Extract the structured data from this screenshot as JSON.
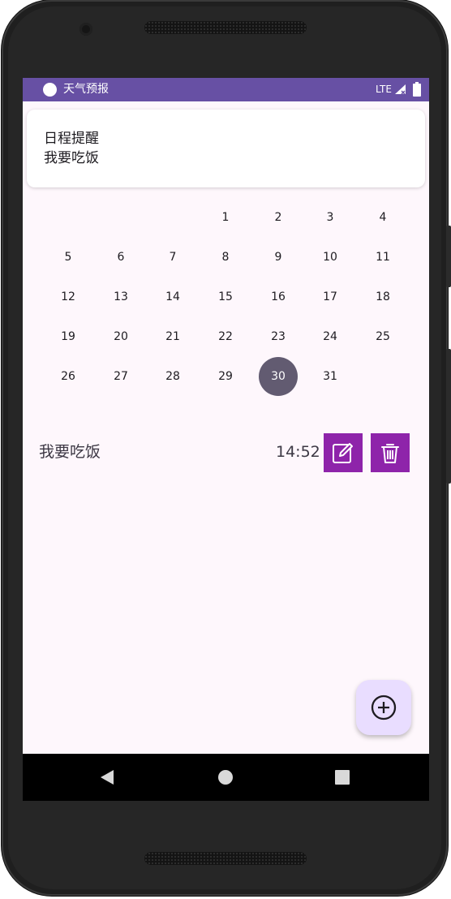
{
  "status_bar": {
    "app_title": "天气预报",
    "network": "LTE",
    "background_color": "#6750a4"
  },
  "reminder": {
    "title": "日程提醒",
    "message": "我要吃饭"
  },
  "calendar": {
    "selected_day": "30",
    "days": [
      "1",
      "2",
      "3",
      "4",
      "5",
      "6",
      "7",
      "8",
      "9",
      "10",
      "11",
      "12",
      "13",
      "14",
      "15",
      "16",
      "17",
      "18",
      "19",
      "20",
      "21",
      "22",
      "23",
      "24",
      "25",
      "26",
      "27",
      "28",
      "29",
      "30",
      "31"
    ]
  },
  "event": {
    "text": "我要吃饭",
    "time": "14:52",
    "edit_icon": "edit-icon",
    "delete_icon": "trash-icon",
    "button_color": "#8e24aa"
  },
  "fab": {
    "icon": "add-circle-icon",
    "color": "#e9ddff"
  },
  "navigation": {
    "back_icon": "back-triangle-icon",
    "home_icon": "home-circle-icon",
    "recents_icon": "recents-square-icon"
  }
}
